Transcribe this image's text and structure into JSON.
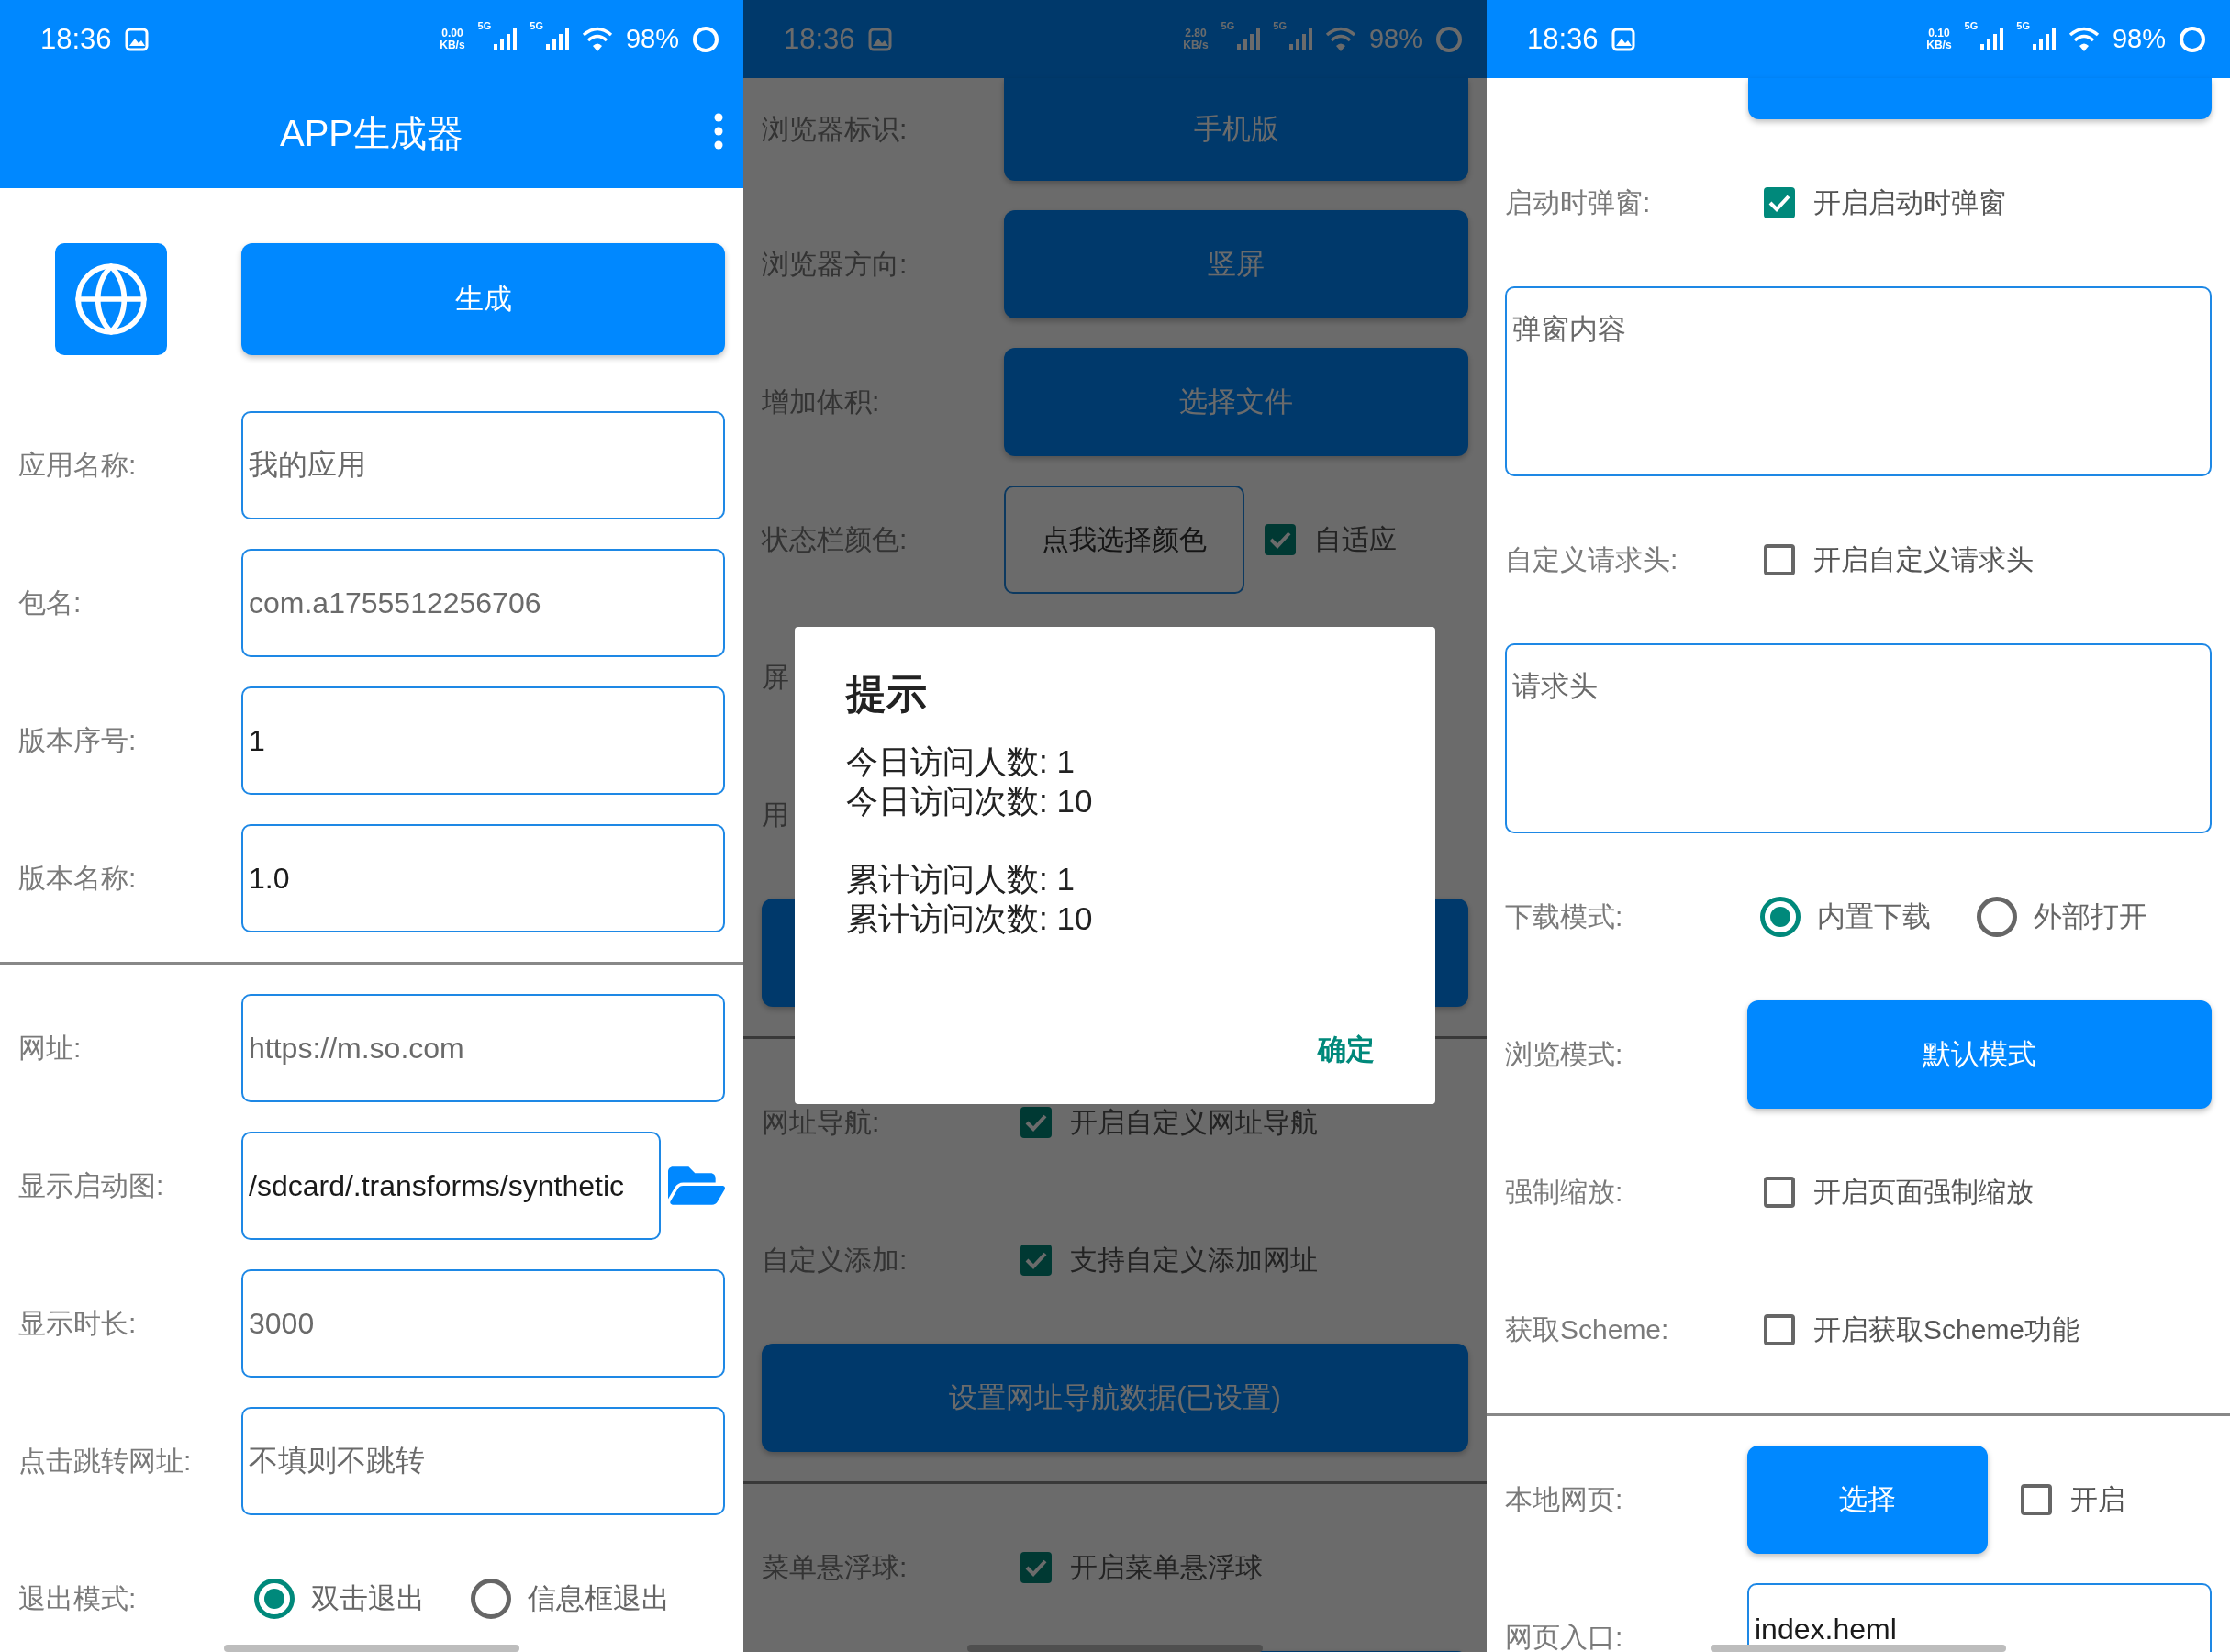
{
  "screens": [
    {
      "status_bar": {
        "time": "18:36",
        "speed": "0.00",
        "speed_unit": "KB/s",
        "networks": [
          "5G",
          "5G"
        ],
        "battery": "98%"
      },
      "app_bar": {
        "title": "APP生成器"
      },
      "rows": [
        {
          "kind": "generate",
          "button": "生成"
        },
        {
          "kind": "field",
          "label": "应用名称:",
          "placeholder": "我的应用"
        },
        {
          "kind": "field",
          "label": "包名:",
          "placeholder": "com.a1755512256706"
        },
        {
          "kind": "field",
          "label": "版本序号:",
          "value": "1"
        },
        {
          "kind": "field",
          "label": "版本名称:",
          "value": "1.0"
        },
        {
          "kind": "divider"
        },
        {
          "kind": "field",
          "label": "网址:",
          "placeholder": "https://m.so.com"
        },
        {
          "kind": "file",
          "label": "显示启动图:",
          "value": "/sdcard/.transforms/synthetic"
        },
        {
          "kind": "field",
          "label": "显示时长:",
          "placeholder": "3000"
        },
        {
          "kind": "field",
          "label": "点击跳转网址:",
          "placeholder": "不填则不跳转"
        },
        {
          "kind": "radio",
          "label": "退出模式:",
          "options": [
            {
              "label": "双击退出",
              "selected": true
            },
            {
              "label": "信息框退出",
              "selected": false
            }
          ]
        }
      ]
    },
    {
      "status_bar": {
        "time": "18:36",
        "speed": "2.80",
        "speed_unit": "KB/s",
        "networks": [
          "5G",
          "5G"
        ],
        "battery": "98%"
      },
      "rows": [
        {
          "kind": "button",
          "label": "浏览器标识:",
          "button": "手机版"
        },
        {
          "kind": "button",
          "label": "浏览器方向:",
          "button": "竖屏"
        },
        {
          "kind": "button",
          "label": "增加体积:",
          "button": "选择文件"
        },
        {
          "kind": "color",
          "label": "状态栏颜色:",
          "button": "点我选择颜色",
          "text": "自适应",
          "checked": true
        },
        {
          "kind": "label",
          "label": "屏"
        },
        {
          "kind": "label",
          "label": "用"
        },
        {
          "kind": "wide_button"
        },
        {
          "kind": "divider"
        },
        {
          "kind": "checkbox",
          "label": "网址导航:",
          "text": "开启自定义网址导航",
          "checked": true
        },
        {
          "kind": "checkbox",
          "label": "自定义添加:",
          "text": "支持自定义添加网址",
          "checked": true
        },
        {
          "kind": "wide_button",
          "button": "设置网址导航数据(已设置)"
        },
        {
          "kind": "divider"
        },
        {
          "kind": "checkbox",
          "label": "菜单悬浮球:",
          "text": "开启菜单悬浮球",
          "checked": true
        },
        {
          "kind": "edge_button"
        }
      ],
      "dialog": {
        "title": "提示",
        "groups": [
          [
            "今日访问人数: 1",
            "今日访问次数: 10"
          ],
          [
            "累计访问人数: 1",
            "累计访问次数: 10"
          ]
        ],
        "button": "确定"
      }
    },
    {
      "status_bar": {
        "time": "18:36",
        "speed": "0.10",
        "speed_unit": "KB/s",
        "networks": [
          "5G",
          "5G"
        ],
        "battery": "98%"
      },
      "rows": [
        {
          "kind": "edge_button"
        },
        {
          "kind": "checkbox",
          "label": "启动时弹窗:",
          "text": "开启启动时弹窗",
          "checked": true
        },
        {
          "kind": "textarea",
          "placeholder": "弹窗内容"
        },
        {
          "kind": "checkbox",
          "label": "自定义请求头:",
          "text": "开启自定义请求头",
          "checked": false
        },
        {
          "kind": "textarea",
          "placeholder": "请求头"
        },
        {
          "kind": "radio",
          "label": "下载模式:",
          "options": [
            {
              "label": "内置下载",
              "selected": true
            },
            {
              "label": "外部打开",
              "selected": false
            }
          ]
        },
        {
          "kind": "button",
          "label": "浏览模式:",
          "button": "默认模式"
        },
        {
          "kind": "checkbox",
          "label": "强制缩放:",
          "text": "开启页面强制缩放",
          "checked": false
        },
        {
          "kind": "checkbox",
          "label": "获取Scheme:",
          "text": "开启获取Scheme功能",
          "checked": false
        },
        {
          "kind": "divider"
        },
        {
          "kind": "button_checkbox",
          "label": "本地网页:",
          "button": "选择",
          "text": "开启",
          "checked": false
        },
        {
          "kind": "field",
          "label": "网页入口:",
          "value": "index.heml"
        }
      ]
    }
  ]
}
